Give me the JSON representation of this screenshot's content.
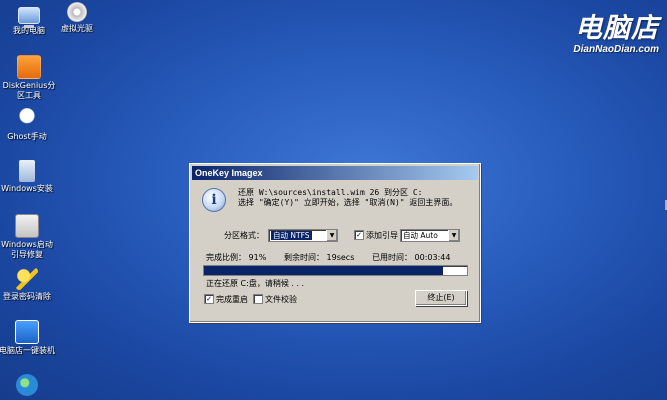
{
  "desktop": {
    "brand": {
      "cn": "电脑店",
      "en": "DianNaoDian.com"
    },
    "icons": [
      {
        "name": "我的电脑"
      },
      {
        "name": "虚拟光驱"
      },
      {
        "name": "DiskGenius分区工具"
      },
      {
        "name": "Ghost手动"
      },
      {
        "name": "Windows安装"
      },
      {
        "name": "Windows启动引导修复"
      },
      {
        "name": "登录密码清除"
      },
      {
        "name": "电脑店一键装机"
      },
      {
        "name": ""
      }
    ]
  },
  "dialog": {
    "title": "OneKey Imagex",
    "message_line1": "还原 W:\\sources\\install.wim 26 到分区 C:",
    "message_line2": "选择 \"确定(Y)\" 立即开始，选择 \"取消(N)\" 返回主界面。",
    "partition_format_label": "分区格式：",
    "partition_format_value": "自动 NTFS",
    "add_boot_label": "添加引导",
    "add_boot_checked": true,
    "boot_mode_value": "自动 Auto",
    "progress_label": "完成比例： 91%",
    "remaining_label": "剩余时间： 19secs",
    "elapsed_label": "已用时间： 00:03:44",
    "progress_percent": 91,
    "status_text": "正在还原 C:盘，请稍候 . . .",
    "reboot_label": "完成重启",
    "reboot_checked": true,
    "verify_label": "文件校验",
    "verify_checked": false,
    "stop_button": "终止(E)"
  }
}
